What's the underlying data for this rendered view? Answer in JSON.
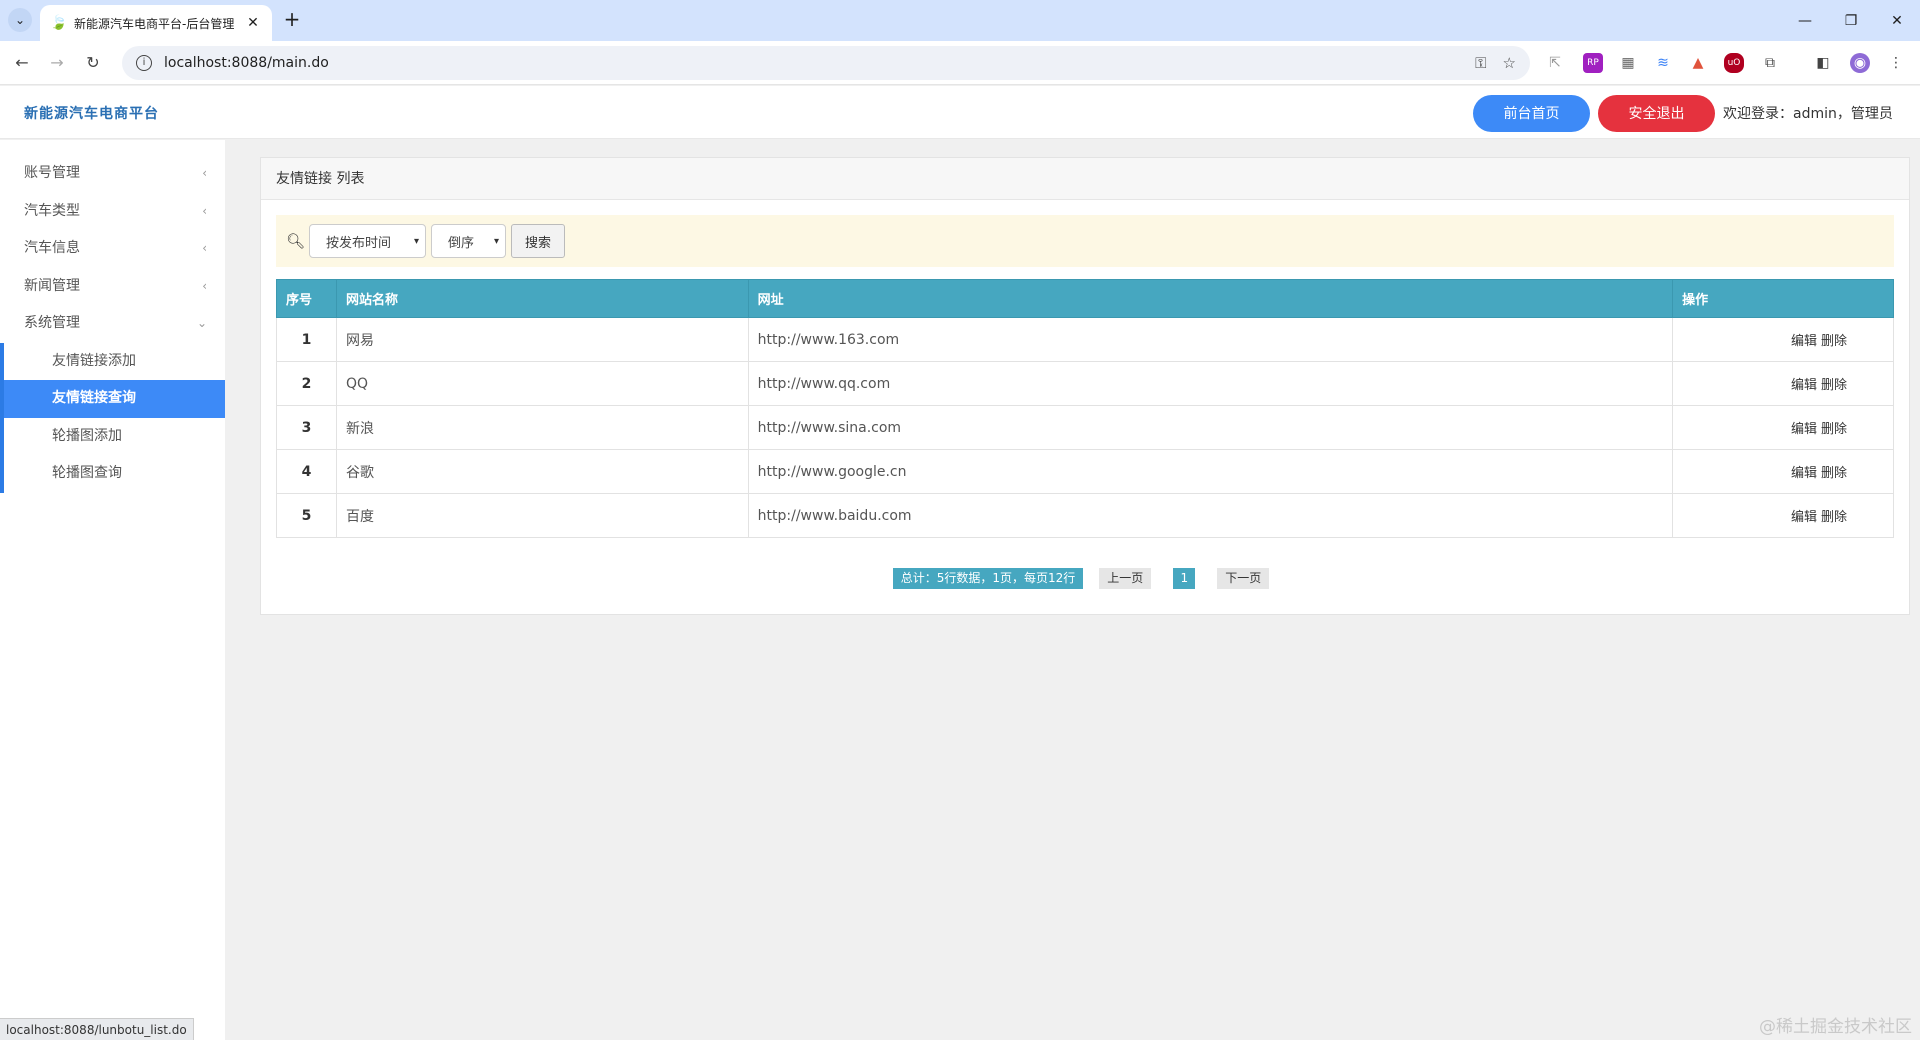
{
  "browser": {
    "tab_title": "新能源汽车电商平台-后台管理",
    "url": "localhost:8088/main.do",
    "status_url": "localhost:8088/lunbotu_list.do"
  },
  "header": {
    "brand": "新能源汽车电商平台",
    "front_button": "前台首页",
    "logout_button": "安全退出",
    "welcome": "欢迎登录：admin，管理员"
  },
  "sidebar": {
    "items": [
      {
        "label": "账号管理"
      },
      {
        "label": "汽车类型"
      },
      {
        "label": "汽车信息"
      },
      {
        "label": "新闻管理"
      },
      {
        "label": "系统管理"
      }
    ],
    "subitems": [
      {
        "label": "友情链接添加"
      },
      {
        "label": "友情链接查询"
      },
      {
        "label": "轮播图添加"
      },
      {
        "label": "轮播图查询"
      }
    ]
  },
  "panel": {
    "title": "友情链接 列表"
  },
  "search": {
    "sort_field": "按发布时间",
    "sort_order": "倒序",
    "button": "搜索"
  },
  "table": {
    "headers": [
      "序号",
      "网站名称",
      "网址",
      "操作"
    ],
    "rows": [
      {
        "idx": "1",
        "name": "网易",
        "url": "http://www.163.com"
      },
      {
        "idx": "2",
        "name": "QQ",
        "url": "http://www.qq.com"
      },
      {
        "idx": "3",
        "name": "新浪",
        "url": "http://www.sina.com"
      },
      {
        "idx": "4",
        "name": "谷歌",
        "url": "http://www.google.cn"
      },
      {
        "idx": "5",
        "name": "百度",
        "url": "http://www.baidu.com"
      }
    ],
    "edit_label": "编辑",
    "delete_label": "删除"
  },
  "pager": {
    "summary": "总计：5行数据，1页，每页12行",
    "prev": "上一页",
    "current": "1",
    "next": "下一页"
  },
  "watermark": "@稀土掘金技术社区"
}
